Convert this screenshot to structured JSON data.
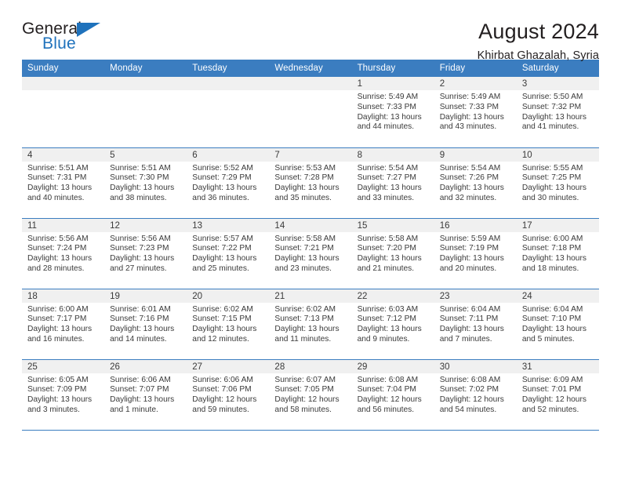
{
  "brand": {
    "word_one": "General",
    "word_two": "Blue",
    "triangle_icon": "brand-triangle-icon"
  },
  "header": {
    "month_title": "August 2024",
    "location": "Khirbat Ghazalah, Syria"
  },
  "calendar": {
    "weekday_headers": [
      "Sunday",
      "Monday",
      "Tuesday",
      "Wednesday",
      "Thursday",
      "Friday",
      "Saturday"
    ],
    "labels": {
      "sunrise": "Sunrise:",
      "sunset": "Sunset:",
      "daylight": "Daylight:"
    },
    "accent_color": "#3b7dc0",
    "daynum_strip_color": "#f0f0f0",
    "weeks": [
      [
        {
          "day": "",
          "empty": true
        },
        {
          "day": "",
          "empty": true
        },
        {
          "day": "",
          "empty": true
        },
        {
          "day": "",
          "empty": true
        },
        {
          "day": "1",
          "sunrise": "Sunrise: 5:49 AM",
          "sunset": "Sunset: 7:33 PM",
          "daylight_a": "Daylight: 13 hours",
          "daylight_b": "and 44 minutes."
        },
        {
          "day": "2",
          "sunrise": "Sunrise: 5:49 AM",
          "sunset": "Sunset: 7:33 PM",
          "daylight_a": "Daylight: 13 hours",
          "daylight_b": "and 43 minutes."
        },
        {
          "day": "3",
          "sunrise": "Sunrise: 5:50 AM",
          "sunset": "Sunset: 7:32 PM",
          "daylight_a": "Daylight: 13 hours",
          "daylight_b": "and 41 minutes."
        }
      ],
      [
        {
          "day": "4",
          "sunrise": "Sunrise: 5:51 AM",
          "sunset": "Sunset: 7:31 PM",
          "daylight_a": "Daylight: 13 hours",
          "daylight_b": "and 40 minutes."
        },
        {
          "day": "5",
          "sunrise": "Sunrise: 5:51 AM",
          "sunset": "Sunset: 7:30 PM",
          "daylight_a": "Daylight: 13 hours",
          "daylight_b": "and 38 minutes."
        },
        {
          "day": "6",
          "sunrise": "Sunrise: 5:52 AM",
          "sunset": "Sunset: 7:29 PM",
          "daylight_a": "Daylight: 13 hours",
          "daylight_b": "and 36 minutes."
        },
        {
          "day": "7",
          "sunrise": "Sunrise: 5:53 AM",
          "sunset": "Sunset: 7:28 PM",
          "daylight_a": "Daylight: 13 hours",
          "daylight_b": "and 35 minutes."
        },
        {
          "day": "8",
          "sunrise": "Sunrise: 5:54 AM",
          "sunset": "Sunset: 7:27 PM",
          "daylight_a": "Daylight: 13 hours",
          "daylight_b": "and 33 minutes."
        },
        {
          "day": "9",
          "sunrise": "Sunrise: 5:54 AM",
          "sunset": "Sunset: 7:26 PM",
          "daylight_a": "Daylight: 13 hours",
          "daylight_b": "and 32 minutes."
        },
        {
          "day": "10",
          "sunrise": "Sunrise: 5:55 AM",
          "sunset": "Sunset: 7:25 PM",
          "daylight_a": "Daylight: 13 hours",
          "daylight_b": "and 30 minutes."
        }
      ],
      [
        {
          "day": "11",
          "sunrise": "Sunrise: 5:56 AM",
          "sunset": "Sunset: 7:24 PM",
          "daylight_a": "Daylight: 13 hours",
          "daylight_b": "and 28 minutes."
        },
        {
          "day": "12",
          "sunrise": "Sunrise: 5:56 AM",
          "sunset": "Sunset: 7:23 PM",
          "daylight_a": "Daylight: 13 hours",
          "daylight_b": "and 27 minutes."
        },
        {
          "day": "13",
          "sunrise": "Sunrise: 5:57 AM",
          "sunset": "Sunset: 7:22 PM",
          "daylight_a": "Daylight: 13 hours",
          "daylight_b": "and 25 minutes."
        },
        {
          "day": "14",
          "sunrise": "Sunrise: 5:58 AM",
          "sunset": "Sunset: 7:21 PM",
          "daylight_a": "Daylight: 13 hours",
          "daylight_b": "and 23 minutes."
        },
        {
          "day": "15",
          "sunrise": "Sunrise: 5:58 AM",
          "sunset": "Sunset: 7:20 PM",
          "daylight_a": "Daylight: 13 hours",
          "daylight_b": "and 21 minutes."
        },
        {
          "day": "16",
          "sunrise": "Sunrise: 5:59 AM",
          "sunset": "Sunset: 7:19 PM",
          "daylight_a": "Daylight: 13 hours",
          "daylight_b": "and 20 minutes."
        },
        {
          "day": "17",
          "sunrise": "Sunrise: 6:00 AM",
          "sunset": "Sunset: 7:18 PM",
          "daylight_a": "Daylight: 13 hours",
          "daylight_b": "and 18 minutes."
        }
      ],
      [
        {
          "day": "18",
          "sunrise": "Sunrise: 6:00 AM",
          "sunset": "Sunset: 7:17 PM",
          "daylight_a": "Daylight: 13 hours",
          "daylight_b": "and 16 minutes."
        },
        {
          "day": "19",
          "sunrise": "Sunrise: 6:01 AM",
          "sunset": "Sunset: 7:16 PM",
          "daylight_a": "Daylight: 13 hours",
          "daylight_b": "and 14 minutes."
        },
        {
          "day": "20",
          "sunrise": "Sunrise: 6:02 AM",
          "sunset": "Sunset: 7:15 PM",
          "daylight_a": "Daylight: 13 hours",
          "daylight_b": "and 12 minutes."
        },
        {
          "day": "21",
          "sunrise": "Sunrise: 6:02 AM",
          "sunset": "Sunset: 7:13 PM",
          "daylight_a": "Daylight: 13 hours",
          "daylight_b": "and 11 minutes."
        },
        {
          "day": "22",
          "sunrise": "Sunrise: 6:03 AM",
          "sunset": "Sunset: 7:12 PM",
          "daylight_a": "Daylight: 13 hours",
          "daylight_b": "and 9 minutes."
        },
        {
          "day": "23",
          "sunrise": "Sunrise: 6:04 AM",
          "sunset": "Sunset: 7:11 PM",
          "daylight_a": "Daylight: 13 hours",
          "daylight_b": "and 7 minutes."
        },
        {
          "day": "24",
          "sunrise": "Sunrise: 6:04 AM",
          "sunset": "Sunset: 7:10 PM",
          "daylight_a": "Daylight: 13 hours",
          "daylight_b": "and 5 minutes."
        }
      ],
      [
        {
          "day": "25",
          "sunrise": "Sunrise: 6:05 AM",
          "sunset": "Sunset: 7:09 PM",
          "daylight_a": "Daylight: 13 hours",
          "daylight_b": "and 3 minutes."
        },
        {
          "day": "26",
          "sunrise": "Sunrise: 6:06 AM",
          "sunset": "Sunset: 7:07 PM",
          "daylight_a": "Daylight: 13 hours",
          "daylight_b": "and 1 minute."
        },
        {
          "day": "27",
          "sunrise": "Sunrise: 6:06 AM",
          "sunset": "Sunset: 7:06 PM",
          "daylight_a": "Daylight: 12 hours",
          "daylight_b": "and 59 minutes."
        },
        {
          "day": "28",
          "sunrise": "Sunrise: 6:07 AM",
          "sunset": "Sunset: 7:05 PM",
          "daylight_a": "Daylight: 12 hours",
          "daylight_b": "and 58 minutes."
        },
        {
          "day": "29",
          "sunrise": "Sunrise: 6:08 AM",
          "sunset": "Sunset: 7:04 PM",
          "daylight_a": "Daylight: 12 hours",
          "daylight_b": "and 56 minutes."
        },
        {
          "day": "30",
          "sunrise": "Sunrise: 6:08 AM",
          "sunset": "Sunset: 7:02 PM",
          "daylight_a": "Daylight: 12 hours",
          "daylight_b": "and 54 minutes."
        },
        {
          "day": "31",
          "sunrise": "Sunrise: 6:09 AM",
          "sunset": "Sunset: 7:01 PM",
          "daylight_a": "Daylight: 12 hours",
          "daylight_b": "and 52 minutes."
        }
      ]
    ]
  }
}
